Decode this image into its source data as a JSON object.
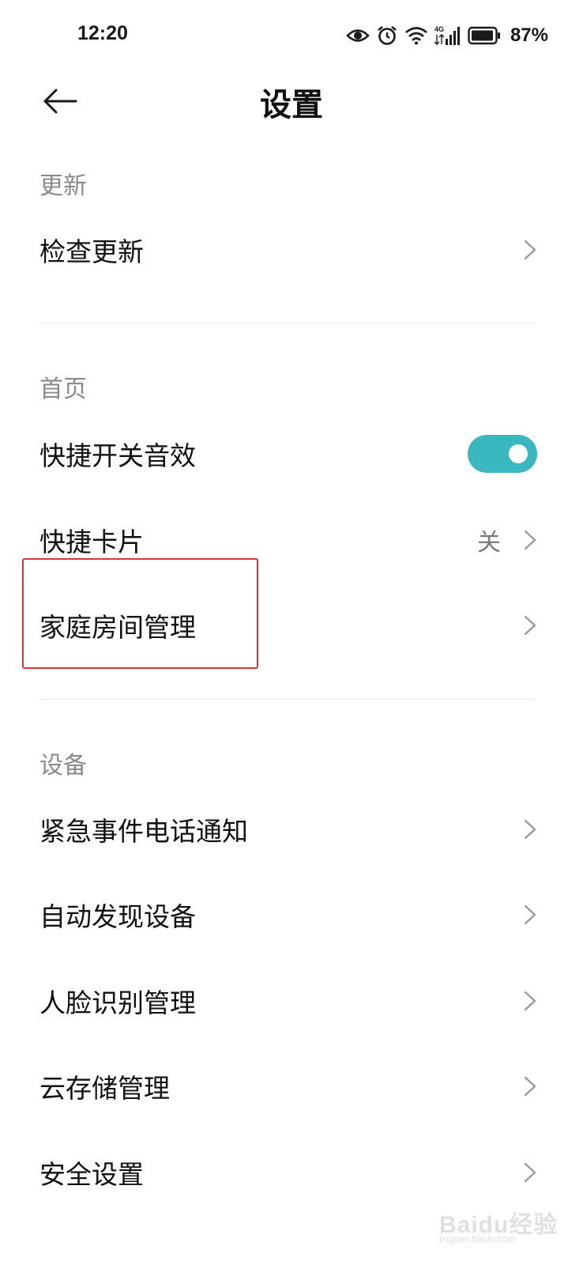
{
  "status_bar": {
    "time": "12:20",
    "battery_percent": "87%",
    "icons": [
      "eye-icon",
      "alarm-icon",
      "wifi-icon",
      "4g-signal-icon",
      "battery-icon"
    ],
    "network_label": "4G"
  },
  "header": {
    "title": "设置",
    "back_icon": "back-arrow-icon"
  },
  "sections": {
    "update": {
      "header": "更新",
      "items": [
        {
          "label": "检查更新",
          "control": "chevron"
        }
      ]
    },
    "home": {
      "header": "首页",
      "items": [
        {
          "label": "快捷开关音效",
          "control": "toggle",
          "toggle_on": true
        },
        {
          "label": "快捷卡片",
          "value": "关",
          "control": "chevron"
        },
        {
          "label": "家庭房间管理",
          "control": "chevron",
          "highlighted": true
        }
      ]
    },
    "device": {
      "header": "设备",
      "items": [
        {
          "label": "紧急事件电话通知",
          "control": "chevron"
        },
        {
          "label": "自动发现设备",
          "control": "chevron"
        },
        {
          "label": "人脸识别管理",
          "control": "chevron"
        },
        {
          "label": "云存储管理",
          "control": "chevron"
        },
        {
          "label": "安全设置",
          "control": "chevron"
        }
      ]
    }
  },
  "colors": {
    "accent": "#3ab8bf",
    "highlight_border": "#d9363e",
    "section_header": "#8a8a8a"
  },
  "watermark": {
    "text": "Baidu经验",
    "sub": "jingyan.baidu.com"
  }
}
